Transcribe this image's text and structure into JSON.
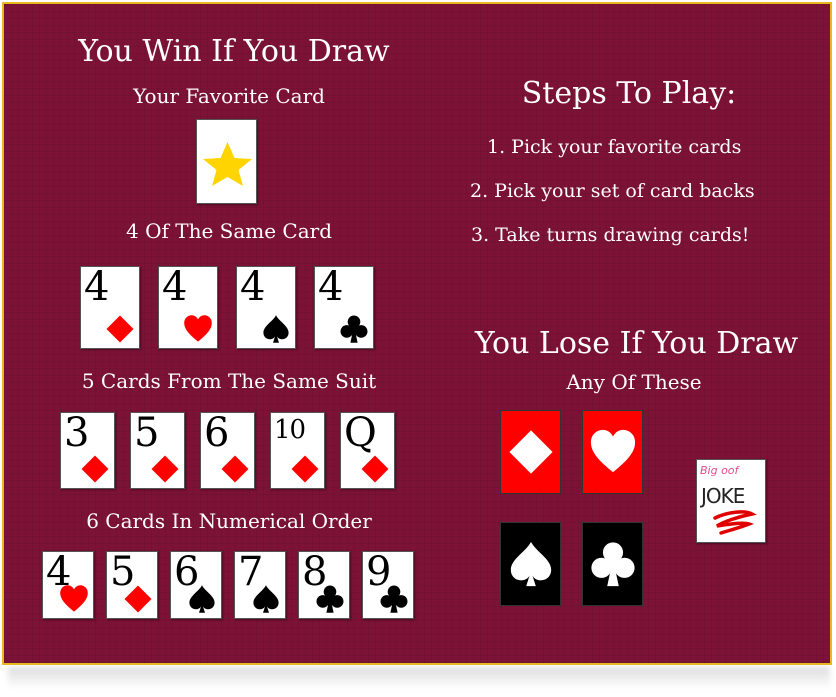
{
  "win": {
    "title": "You Win If You Draw",
    "favorite_label": "Your Favorite Card",
    "same_card_label": "4 Of The Same Card",
    "same_card_cards": [
      {
        "rank": "4",
        "suit": "diamond",
        "color": "#ff0000"
      },
      {
        "rank": "4",
        "suit": "heart",
        "color": "#ff0000"
      },
      {
        "rank": "4",
        "suit": "spade",
        "color": "#000000"
      },
      {
        "rank": "4",
        "suit": "club",
        "color": "#000000"
      }
    ],
    "same_suit_label": "5 Cards From The Same Suit",
    "same_suit_cards": [
      {
        "rank": "3",
        "suit": "diamond",
        "color": "#ff0000"
      },
      {
        "rank": "5",
        "suit": "diamond",
        "color": "#ff0000"
      },
      {
        "rank": "6",
        "suit": "diamond",
        "color": "#ff0000"
      },
      {
        "rank": "10",
        "suit": "diamond",
        "color": "#ff0000"
      },
      {
        "rank": "Q",
        "suit": "diamond",
        "color": "#ff0000"
      }
    ],
    "order_label": "6 Cards In Numerical Order",
    "order_cards": [
      {
        "rank": "4",
        "suit": "heart",
        "color": "#ff0000"
      },
      {
        "rank": "5",
        "suit": "diamond",
        "color": "#ff0000"
      },
      {
        "rank": "6",
        "suit": "spade",
        "color": "#000000"
      },
      {
        "rank": "7",
        "suit": "spade",
        "color": "#000000"
      },
      {
        "rank": "8",
        "suit": "club",
        "color": "#000000"
      },
      {
        "rank": "9",
        "suit": "club",
        "color": "#000000"
      }
    ]
  },
  "steps": {
    "title": "Steps To Play:",
    "items": [
      "1.  Pick your favorite cards",
      "2.  Pick your set of card backs",
      "3.  Take turns drawing cards!"
    ]
  },
  "lose": {
    "title": "You Lose If You Draw",
    "subtitle": "Any Of These",
    "backs": [
      {
        "suit": "diamond",
        "bg": "#ff0000"
      },
      {
        "suit": "heart",
        "bg": "#ff0000"
      },
      {
        "suit": "spade",
        "bg": "#000000"
      },
      {
        "suit": "club",
        "bg": "#000000"
      }
    ],
    "joke": {
      "top": "Big oof",
      "main": "JOKE"
    }
  },
  "colors": {
    "background": "#7c1235",
    "border": "#e8b81f",
    "star": "#ffd400"
  }
}
